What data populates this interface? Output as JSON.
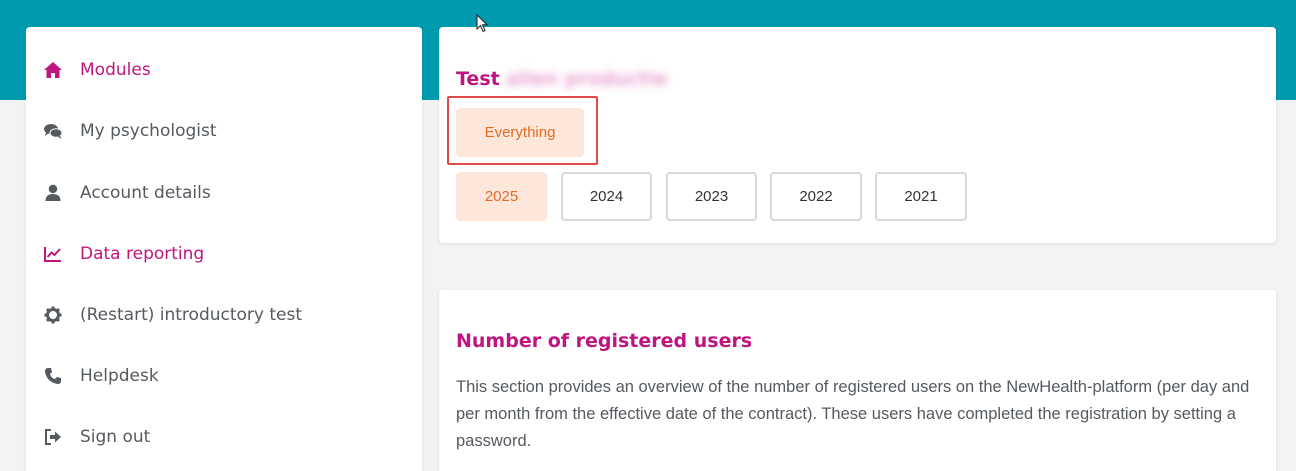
{
  "sidebar": {
    "items": [
      {
        "label": "Modules",
        "icon": "home-icon",
        "active": true
      },
      {
        "label": "My psychologist",
        "icon": "chat-icon",
        "active": false
      },
      {
        "label": "Account details",
        "icon": "user-icon",
        "active": false
      },
      {
        "label": "Data reporting",
        "icon": "chart-line-icon",
        "active": true
      },
      {
        "label": "(Restart) introductory test",
        "icon": "gear-icon",
        "active": false
      },
      {
        "label": "Helpdesk",
        "icon": "phone-icon",
        "active": false
      },
      {
        "label": "Sign out",
        "icon": "sign-out-icon",
        "active": false
      }
    ]
  },
  "filter_card": {
    "title": "Test",
    "title_blurred": "allen productie",
    "everything_label": "Everything",
    "years": [
      "2025",
      "2024",
      "2023",
      "2022",
      "2021"
    ],
    "selected_year": "2025"
  },
  "section": {
    "title": "Number of registered users",
    "text": "This section provides an overview of the number of registered users on the NewHealth-platform (per day and per month from the effective date of the contract). These users have completed the registration by setting a password."
  },
  "colors": {
    "header": "#009aaf",
    "accent": "#c0147f",
    "selected_bg": "#fde6da",
    "selected_text": "#e46b27",
    "highlight": "#e04a4a"
  }
}
